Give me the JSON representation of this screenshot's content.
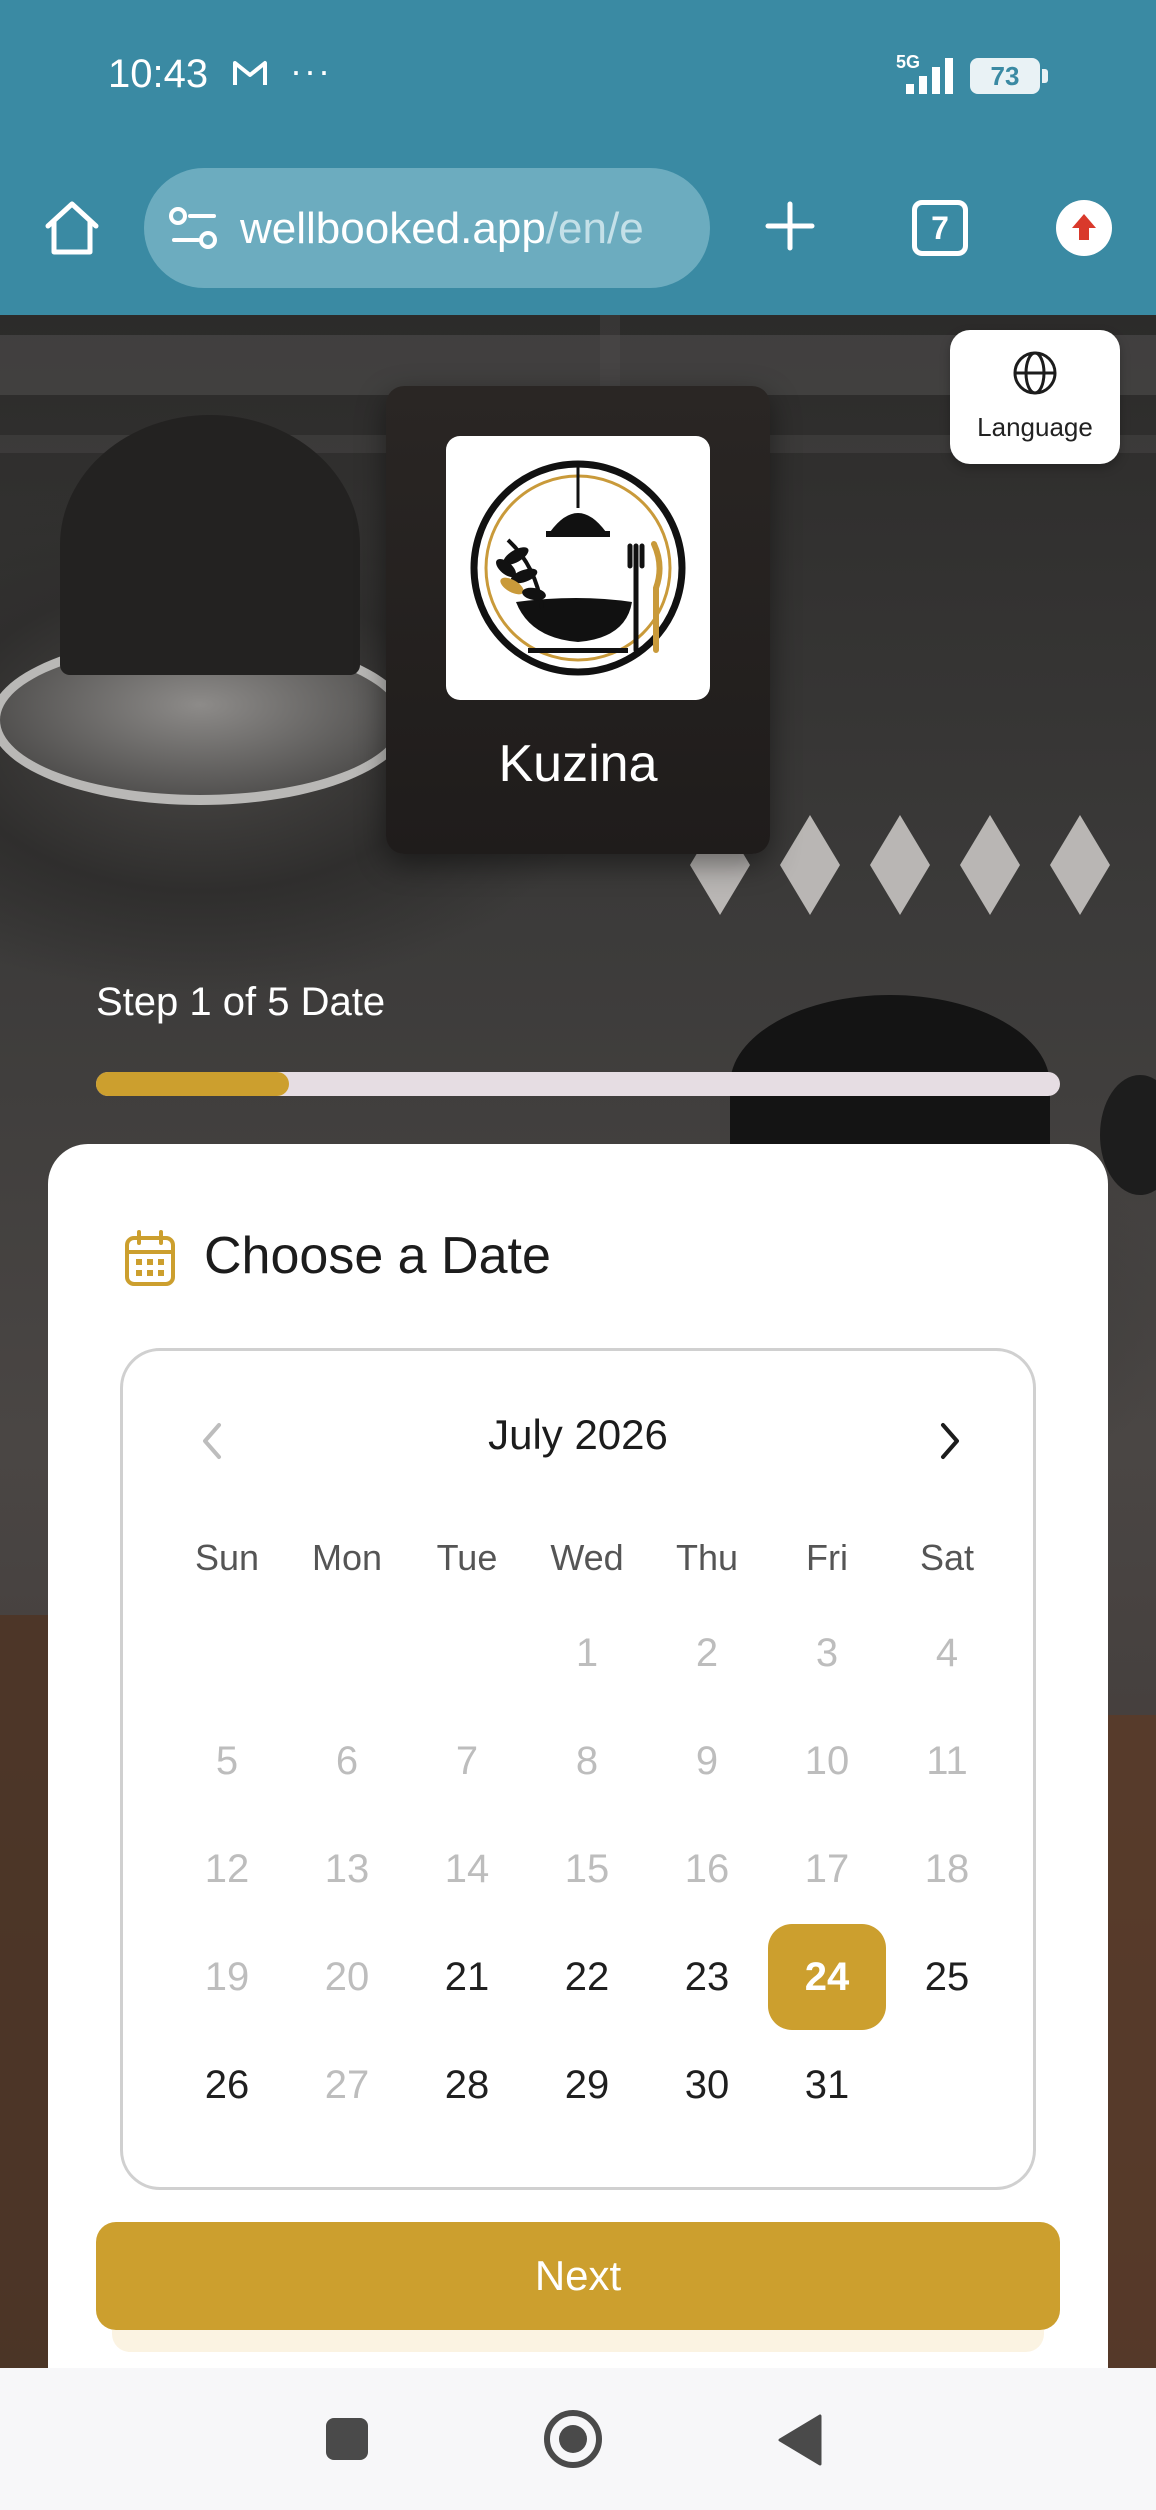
{
  "status_bar": {
    "time": "10:43",
    "more": "···",
    "network": "5G",
    "battery": "73",
    "icons": [
      "gmail-icon",
      "signal-icon",
      "battery-icon"
    ]
  },
  "browser": {
    "url_host": "wellbooked.app",
    "url_path": "/en/e",
    "tab_count": "7",
    "icons": [
      "home-icon",
      "site-settings-icon",
      "new-tab-icon",
      "tabs-icon",
      "update-icon"
    ]
  },
  "language_button": {
    "label": "Language",
    "icon": "globe-icon"
  },
  "restaurant": {
    "name": "Kuzina",
    "logo": "restaurant-logo"
  },
  "step": {
    "label": "Step 1 of 5 Date",
    "progress": 0.2
  },
  "colors": {
    "accent": "#cc9f2e",
    "chrome": "#3a8aa3",
    "track": "#e6dde3"
  },
  "card": {
    "title": "Choose a Date",
    "icon": "calendar-icon"
  },
  "calendar": {
    "month_label": "July 2026",
    "weekdays": [
      "Sun",
      "Mon",
      "Tue",
      "Wed",
      "Thu",
      "Fri",
      "Sat"
    ],
    "days": [
      {
        "label": "",
        "state": "empty"
      },
      {
        "label": "",
        "state": "empty"
      },
      {
        "label": "",
        "state": "empty"
      },
      {
        "label": "1",
        "state": "disabled"
      },
      {
        "label": "2",
        "state": "disabled"
      },
      {
        "label": "3",
        "state": "disabled"
      },
      {
        "label": "4",
        "state": "disabled"
      },
      {
        "label": "5",
        "state": "disabled"
      },
      {
        "label": "6",
        "state": "disabled"
      },
      {
        "label": "7",
        "state": "disabled"
      },
      {
        "label": "8",
        "state": "disabled"
      },
      {
        "label": "9",
        "state": "disabled"
      },
      {
        "label": "10",
        "state": "disabled"
      },
      {
        "label": "11",
        "state": "disabled"
      },
      {
        "label": "12",
        "state": "disabled"
      },
      {
        "label": "13",
        "state": "disabled"
      },
      {
        "label": "14",
        "state": "disabled"
      },
      {
        "label": "15",
        "state": "disabled"
      },
      {
        "label": "16",
        "state": "disabled"
      },
      {
        "label": "17",
        "state": "disabled"
      },
      {
        "label": "18",
        "state": "disabled"
      },
      {
        "label": "19",
        "state": "disabled"
      },
      {
        "label": "20",
        "state": "disabled"
      },
      {
        "label": "21",
        "state": "enabled"
      },
      {
        "label": "22",
        "state": "enabled"
      },
      {
        "label": "23",
        "state": "enabled"
      },
      {
        "label": "24",
        "state": "selected"
      },
      {
        "label": "25",
        "state": "enabled"
      },
      {
        "label": "26",
        "state": "enabled"
      },
      {
        "label": "27",
        "state": "disabled"
      },
      {
        "label": "28",
        "state": "enabled"
      },
      {
        "label": "29",
        "state": "enabled"
      },
      {
        "label": "30",
        "state": "enabled"
      },
      {
        "label": "31",
        "state": "enabled"
      }
    ]
  },
  "next_button": {
    "label": "Next"
  },
  "nav_bar": {
    "icons": [
      "recents-icon",
      "home-nav-icon",
      "back-icon"
    ]
  }
}
